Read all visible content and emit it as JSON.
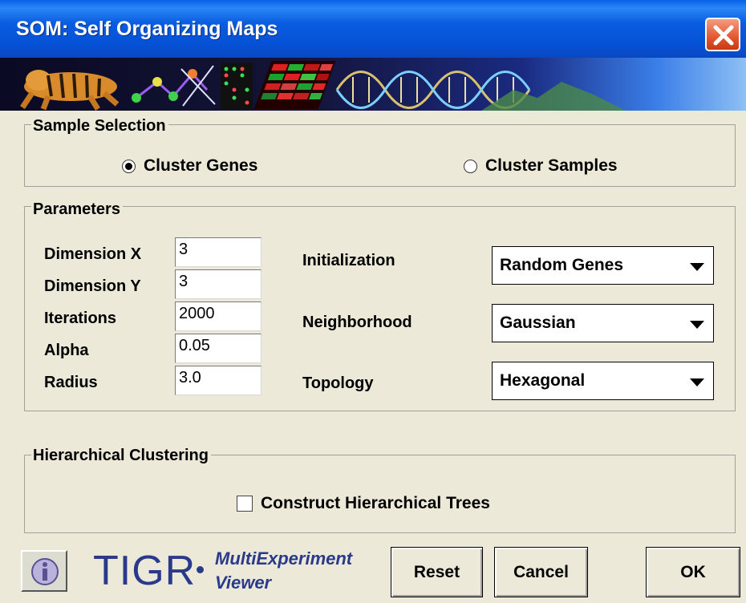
{
  "window": {
    "title": "SOM: Self Organizing Maps"
  },
  "sample_selection": {
    "legend": "Sample Selection",
    "options": [
      {
        "label": "Cluster Genes",
        "selected": true
      },
      {
        "label": "Cluster Samples",
        "selected": false
      }
    ]
  },
  "parameters": {
    "legend": "Parameters",
    "fields": [
      {
        "label": "Dimension X",
        "value": "3"
      },
      {
        "label": "Dimension Y",
        "value": "3"
      },
      {
        "label": "Iterations",
        "value": "2000"
      },
      {
        "label": "Alpha",
        "value": "0.05"
      },
      {
        "label": "Radius",
        "value": "3.0"
      }
    ],
    "selects": [
      {
        "label": "Initialization",
        "value": "Random Genes"
      },
      {
        "label": "Neighborhood",
        "value": "Gaussian"
      },
      {
        "label": "Topology",
        "value": "Hexagonal"
      }
    ]
  },
  "hierarchical": {
    "legend": "Hierarchical Clustering",
    "checkbox_label": "Construct Hierarchical Trees",
    "checked": false
  },
  "footer": {
    "logo_text": "TIGR",
    "logo_sub1": "MultiExperiment",
    "logo_sub2": "Viewer",
    "reset_label": "Reset",
    "cancel_label": "Cancel",
    "ok_label": "OK"
  },
  "colors": {
    "title_blue": "#0652d6",
    "close_red": "#e2572e",
    "logo_blue": "#2a3a8a"
  },
  "icons": [
    "close-icon",
    "info-icon",
    "dropdown-arrow-icon"
  ]
}
